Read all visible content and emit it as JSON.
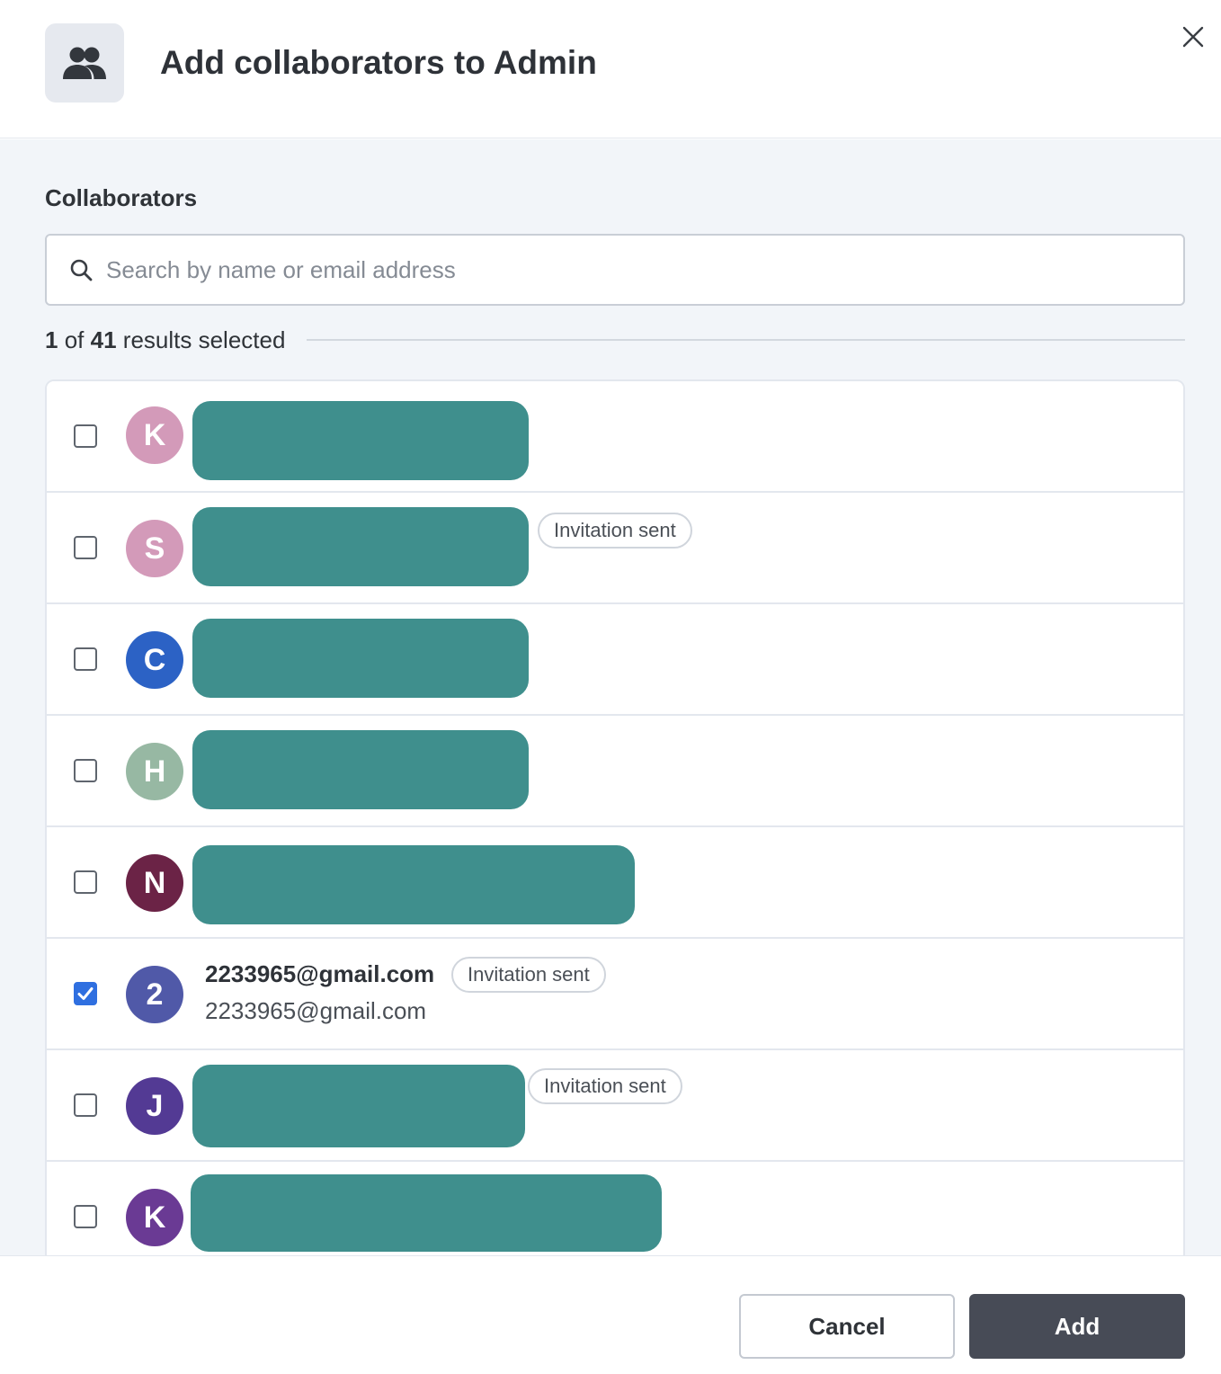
{
  "dialog": {
    "title": "Add collaborators to Admin",
    "close_label": ""
  },
  "section": {
    "label": "Collaborators"
  },
  "search": {
    "placeholder": "Search by name or email address",
    "value": ""
  },
  "results": {
    "selected": "1",
    "of": "of",
    "total": "41",
    "suffix": "results selected"
  },
  "rows": [
    {
      "initial": "K",
      "avatar_color": "#d39ab9",
      "checked": false,
      "badge": "",
      "name": "",
      "email": ""
    },
    {
      "initial": "S",
      "avatar_color": "#d39ab9",
      "checked": false,
      "badge": "Invitation sent",
      "name": "",
      "email": ""
    },
    {
      "initial": "C",
      "avatar_color": "#2c62c5",
      "checked": false,
      "badge": "",
      "name": "",
      "email": ""
    },
    {
      "initial": "H",
      "avatar_color": "#97b8a3",
      "checked": false,
      "badge": "",
      "name": "",
      "email": ""
    },
    {
      "initial": "N",
      "avatar_color": "#6b2346",
      "checked": false,
      "badge": "",
      "name": "",
      "email": ""
    },
    {
      "initial": "2",
      "avatar_color": "#5059a8",
      "checked": true,
      "badge": "Invitation sent",
      "name": "2233965@gmail.com",
      "email": "2233965@gmail.com"
    },
    {
      "initial": "J",
      "avatar_color": "#533a94",
      "checked": false,
      "badge": "Invitation sent",
      "name": "",
      "email": ""
    },
    {
      "initial": "K",
      "avatar_color": "#6a3a94",
      "checked": false,
      "badge": "",
      "name": "",
      "email": ""
    }
  ],
  "footer": {
    "cancel_label": "Cancel",
    "add_label": "Add"
  },
  "colors": {
    "primary_button": "#474b56",
    "checkbox_checked": "#2f6fe0",
    "redaction": "#3f8f8d"
  }
}
